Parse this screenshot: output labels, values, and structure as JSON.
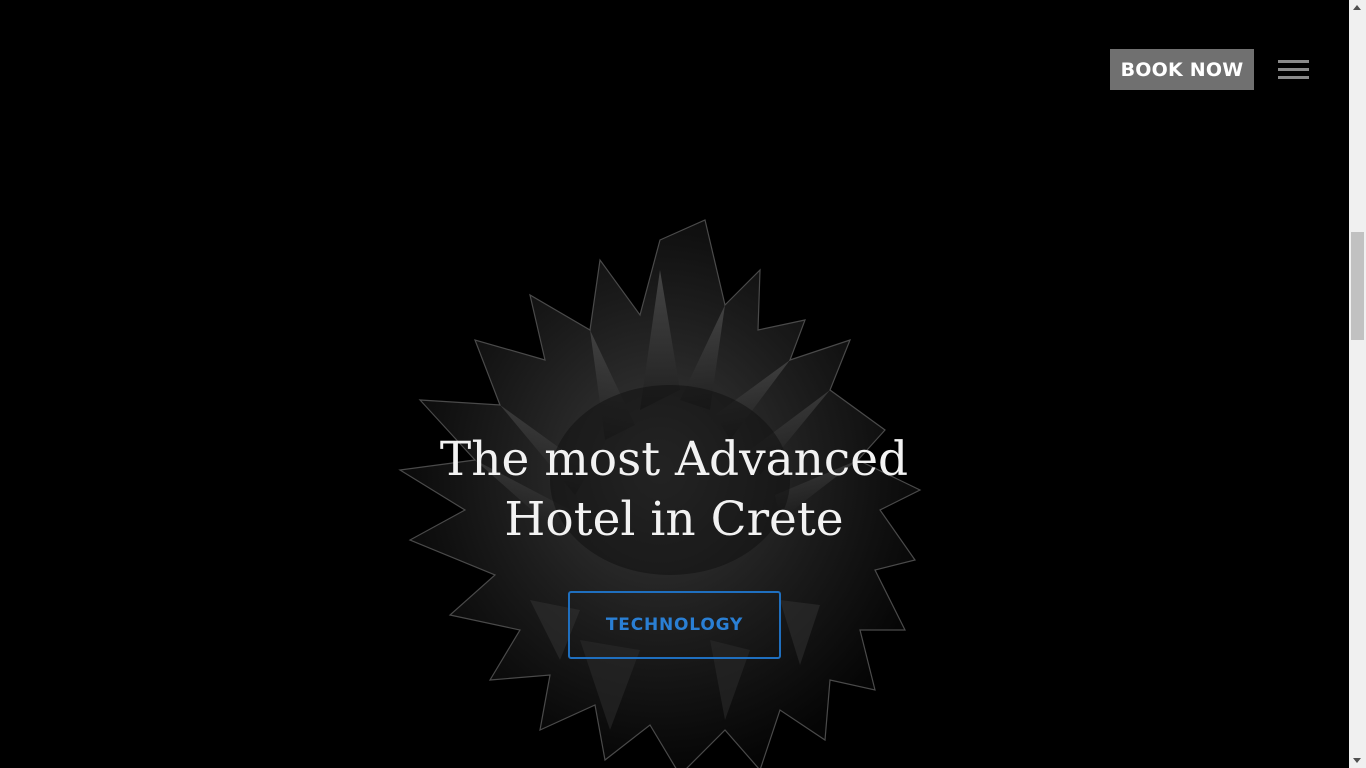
{
  "header": {
    "book_label": "BOOK NOW",
    "menu_icon": "hamburger-menu-icon"
  },
  "hero": {
    "title_line1": "The most Advanced",
    "title_line2": "Hotel in Crete",
    "cta_label": "TECHNOLOGY",
    "image": "dark-spiky-sculpture"
  },
  "colors": {
    "background": "#000000",
    "book_button": "#707070",
    "cta_border": "#1f6fbf",
    "cta_text": "#2a7fd4",
    "title_text": "#f2f2f2"
  }
}
